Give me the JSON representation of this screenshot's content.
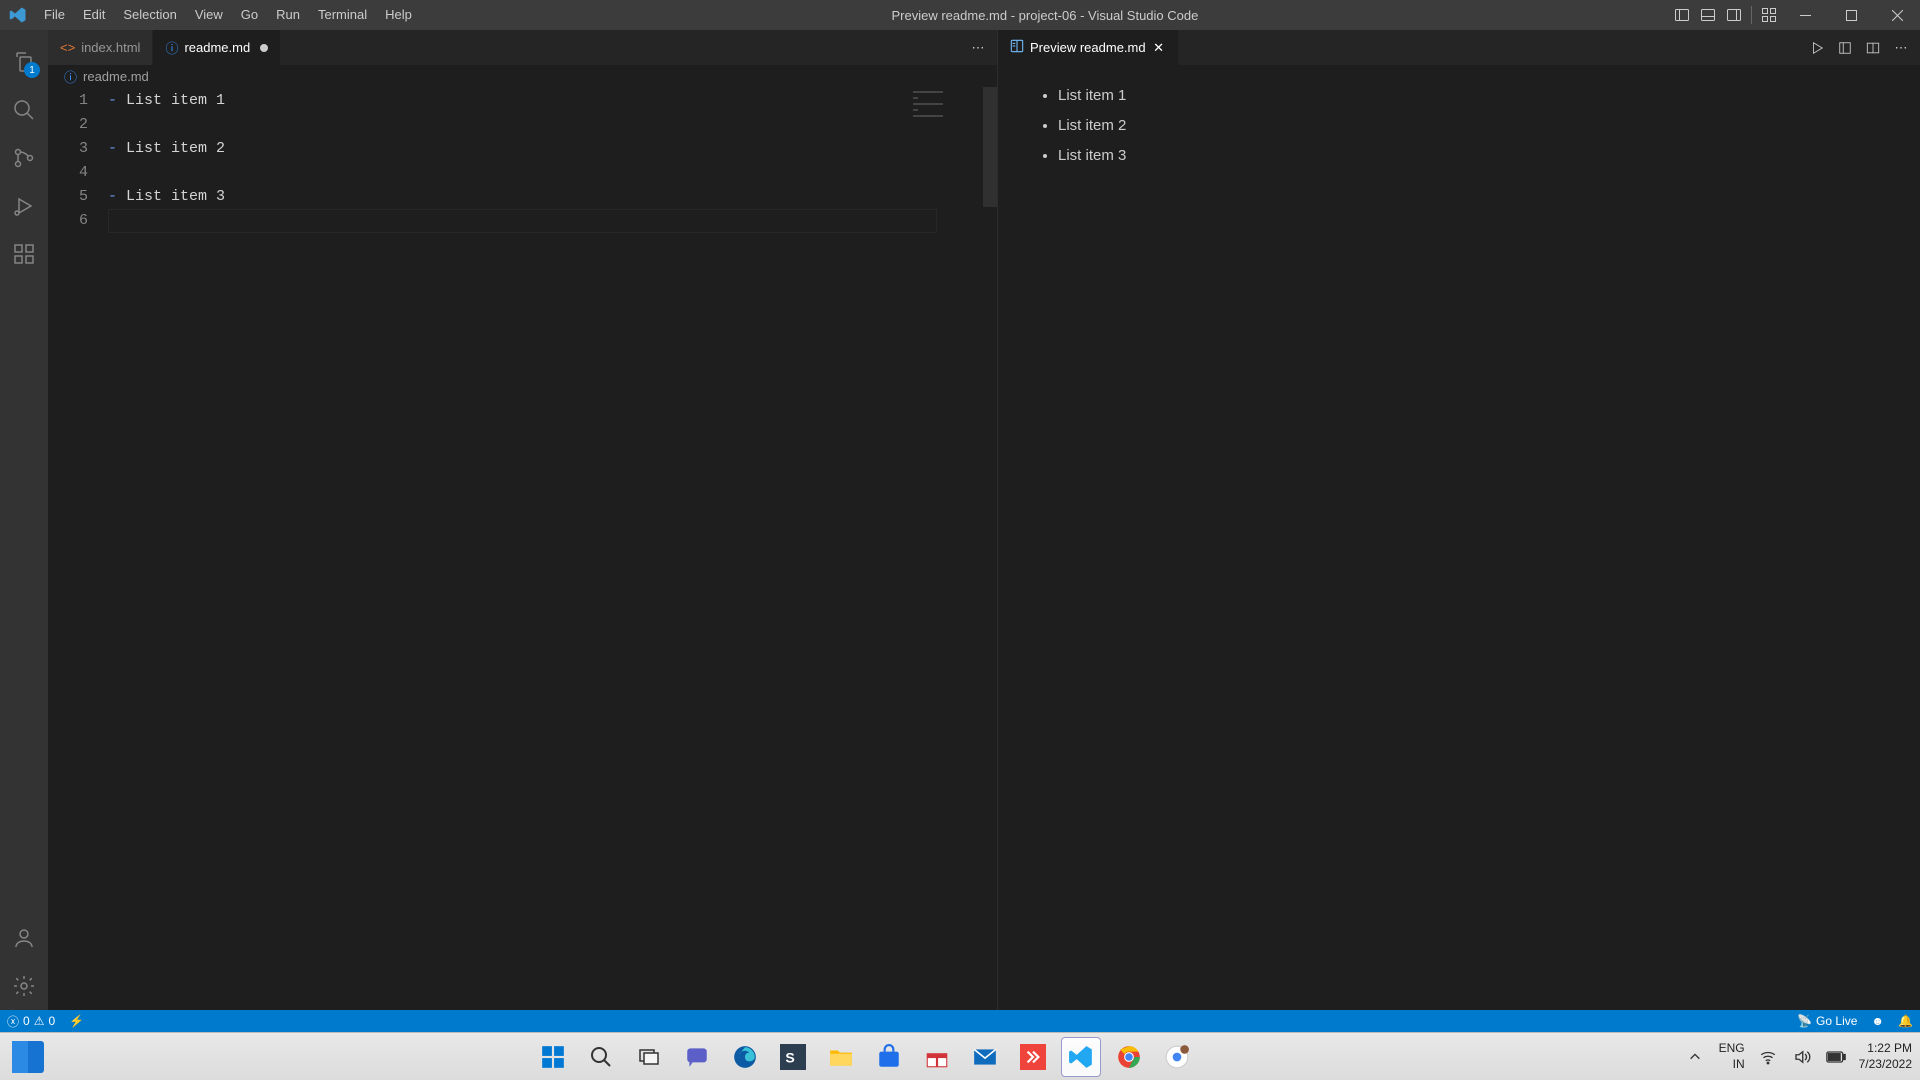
{
  "titlebar": {
    "title": "Preview readme.md - project-06 - Visual Studio Code"
  },
  "menu": [
    "File",
    "Edit",
    "Selection",
    "View",
    "Go",
    "Run",
    "Terminal",
    "Help"
  ],
  "activity": {
    "explorer_badge": "1"
  },
  "tabs": {
    "left": [
      {
        "label": "index.html",
        "active": false,
        "dirty": false,
        "icon": "html"
      },
      {
        "label": "readme.md",
        "active": true,
        "dirty": true,
        "icon": "info"
      }
    ],
    "right": [
      {
        "label": "Preview readme.md",
        "active": true,
        "icon": "preview"
      }
    ]
  },
  "breadcrumb": {
    "file": "readme.md"
  },
  "editor": {
    "lines": [
      {
        "n": "1",
        "dash": "-",
        "text": " List item 1"
      },
      {
        "n": "2",
        "dash": "",
        "text": ""
      },
      {
        "n": "3",
        "dash": "-",
        "text": " List item 2"
      },
      {
        "n": "4",
        "dash": "",
        "text": ""
      },
      {
        "n": "5",
        "dash": "-",
        "text": " List item 3"
      },
      {
        "n": "6",
        "dash": "",
        "text": ""
      }
    ],
    "cursor_line_index": 5
  },
  "preview": {
    "items": [
      "List item 1",
      "List item 2",
      "List item 3"
    ]
  },
  "statusbar": {
    "errors": "0",
    "warnings": "0",
    "golive": "Go Live"
  },
  "system_tray": {
    "lang1": "ENG",
    "lang2": "IN",
    "time": "1:22 PM",
    "date": "7/23/2022"
  }
}
